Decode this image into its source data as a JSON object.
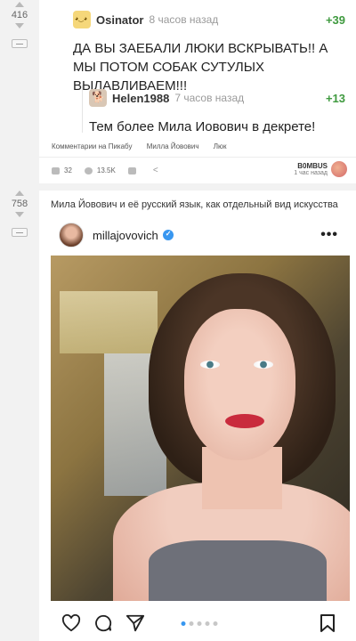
{
  "post1": {
    "rating": "416",
    "comment": {
      "user": "Osinator",
      "time": "8 часов назад",
      "score": "+39",
      "text": "ДА ВЫ ЗАЕБАЛИ ЛЮКИ ВСКРЫВАТЬ!! А МЫ ПОТОМ СОБАК СУТУЛЫХ ВЫЛАВЛИВАЕМ!!!"
    },
    "reply": {
      "user": "Helen1988",
      "time": "7 часов назад",
      "score": "+13",
      "text": "Тем более Мила Иовович в декрете!"
    },
    "tags": [
      "Комментарии на Пикабу",
      "Милла Йовович",
      "Люк"
    ],
    "stats": {
      "comments": "32",
      "views": "13.5K"
    },
    "author": {
      "name": "B0MBUS",
      "time": "1 час назад"
    }
  },
  "post2": {
    "rating": "758",
    "title": "Мила Йовович и её русский язык, как отдельный вид искусства",
    "instagram": {
      "username": "millajovovich",
      "more": "•••"
    },
    "carousel": {
      "count": 5,
      "active": 0
    }
  },
  "colors": {
    "score_green": "#3f9a3f",
    "ig_blue": "#3897f0"
  }
}
